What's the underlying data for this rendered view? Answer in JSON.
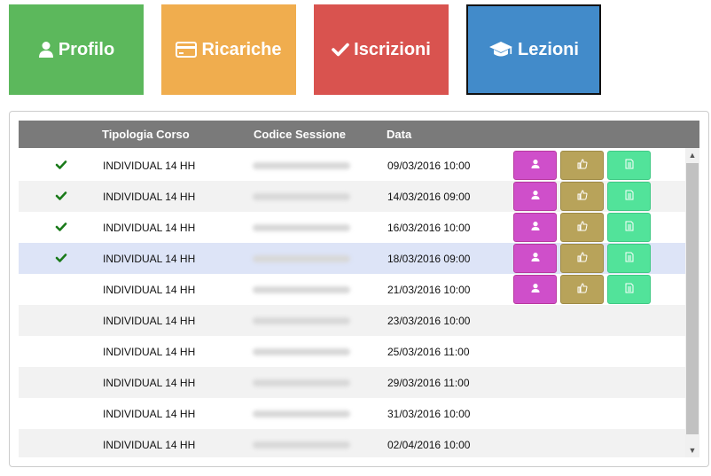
{
  "nav": {
    "profilo": "Profilo",
    "ricariche": "Ricariche",
    "iscrizioni": "Iscrizioni",
    "lezioni": "Lezioni"
  },
  "colors": {
    "profilo": "#5cb85c",
    "ricariche": "#f0ad4e",
    "iscrizioni": "#d9534f",
    "lezioni": "#428bca",
    "header": "#7a7a7a",
    "check": "#1a7a1a",
    "btn_user": "#cf4fca",
    "btn_like": "#b8a35a",
    "btn_doc": "#52e39a"
  },
  "table": {
    "headers": {
      "tipologia": "Tipologia Corso",
      "codice": "Codice Sessione",
      "data": "Data"
    },
    "rows": [
      {
        "checked": true,
        "tipologia": "INDIVIDUAL 14 HH",
        "data": "09/03/2016 10:00",
        "actions": true,
        "selected": false
      },
      {
        "checked": true,
        "tipologia": "INDIVIDUAL 14 HH",
        "data": "14/03/2016 09:00",
        "actions": true,
        "selected": false
      },
      {
        "checked": true,
        "tipologia": "INDIVIDUAL 14 HH",
        "data": "16/03/2016 10:00",
        "actions": true,
        "selected": false
      },
      {
        "checked": true,
        "tipologia": "INDIVIDUAL 14 HH",
        "data": "18/03/2016 09:00",
        "actions": true,
        "selected": true
      },
      {
        "checked": false,
        "tipologia": "INDIVIDUAL 14 HH",
        "data": "21/03/2016 10:00",
        "actions": true,
        "selected": false
      },
      {
        "checked": false,
        "tipologia": "INDIVIDUAL 14 HH",
        "data": "23/03/2016 10:00",
        "actions": false,
        "selected": false
      },
      {
        "checked": false,
        "tipologia": "INDIVIDUAL 14 HH",
        "data": "25/03/2016 11:00",
        "actions": false,
        "selected": false
      },
      {
        "checked": false,
        "tipologia": "INDIVIDUAL 14 HH",
        "data": "29/03/2016 11:00",
        "actions": false,
        "selected": false
      },
      {
        "checked": false,
        "tipologia": "INDIVIDUAL 14 HH",
        "data": "31/03/2016 10:00",
        "actions": false,
        "selected": false
      },
      {
        "checked": false,
        "tipologia": "INDIVIDUAL 14 HH",
        "data": "02/04/2016 10:00",
        "actions": false,
        "selected": false
      }
    ]
  },
  "icons": {
    "profilo": "user-icon",
    "ricariche": "credit-card-icon",
    "iscrizioni": "check-icon",
    "lezioni": "graduation-cap-icon",
    "row_check": "check-icon",
    "action_user": "user-icon",
    "action_like": "thumbs-up-icon",
    "action_doc": "document-icon"
  }
}
